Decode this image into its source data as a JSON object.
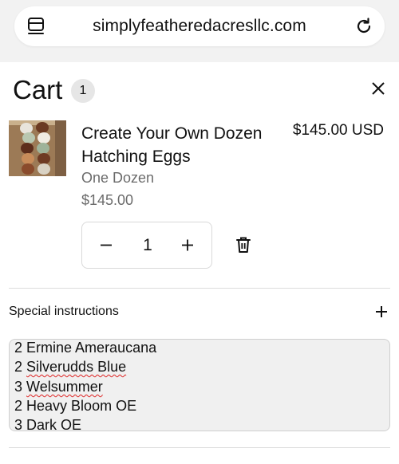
{
  "browser": {
    "url": "simplyfeatheredacresllc.com"
  },
  "cart": {
    "title": "Cart",
    "count": "1"
  },
  "item": {
    "title": "Create Your Own Dozen Hatching Eggs",
    "variant": "One Dozen",
    "unit_price": "$145.00",
    "total_price": "$145.00 USD",
    "quantity": "1"
  },
  "special_instructions": {
    "label": "Special instructions",
    "lines": [
      {
        "qty": "2",
        "name": "Ermine Ameraucana"
      },
      {
        "qty": "2",
        "name": "Silverudds Blue"
      },
      {
        "qty": "3",
        "name": "Welsummer"
      },
      {
        "qty": "2",
        "name": "Heavy Bloom OE"
      },
      {
        "qty": "3",
        "name": "Dark OE"
      }
    ]
  },
  "icons": {
    "tabs": "tabs-icon",
    "reload": "reload-icon",
    "close": "close-icon",
    "minus": "minus-icon",
    "plus": "plus-icon",
    "trash": "trash-icon"
  }
}
